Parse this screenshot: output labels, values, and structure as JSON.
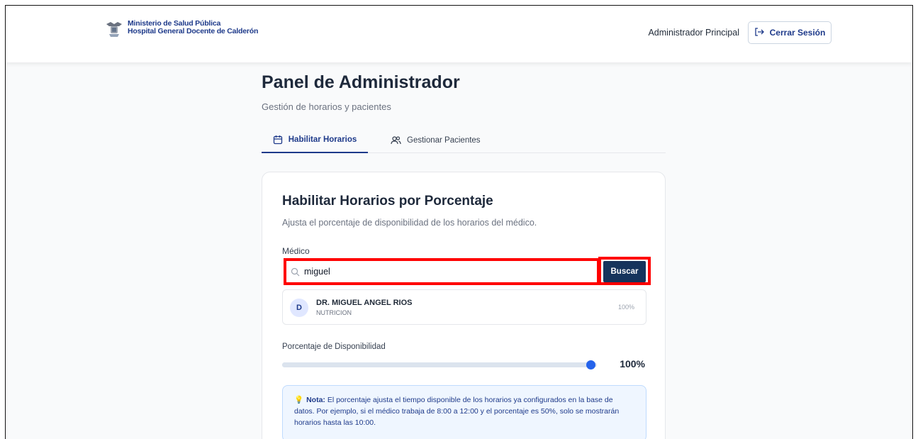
{
  "header": {
    "brand_line1": "Ministerio de Salud Pública",
    "brand_line2": "Hospital General Docente de Calderón",
    "user_name": "Administrador Principal",
    "logout_label": "Cerrar Sesión"
  },
  "page": {
    "title": "Panel de Administrador",
    "subtitle": "Gestión de horarios y pacientes"
  },
  "tabs": [
    {
      "label": "Habilitar Horarios",
      "active": true,
      "icon": "calendar-icon"
    },
    {
      "label": "Gestionar Pacientes",
      "active": false,
      "icon": "users-icon"
    }
  ],
  "card": {
    "title": "Habilitar Horarios por Porcentaje",
    "subtitle": "Ajusta el porcentaje de disponibilidad de los horarios del médico.",
    "doctor_label": "Médico",
    "search_value": "miguel",
    "search_button": "Buscar",
    "results": [
      {
        "initial": "D",
        "name": "DR. MIGUEL ANGEL RIOS",
        "specialty": "NUTRICION",
        "percent": "100%"
      }
    ],
    "percent_label": "Porcentaje de Disponibilidad",
    "percent_value": "100%",
    "percent_fraction": 0.98,
    "note_title": "Nota:",
    "note_text": " El porcentaje ajusta el tiempo disponible de los horarios ya configurados en la base de datos. Por ejemplo, si el médico trabaja de 8:00 a 12:00 y el porcentaje es 50%, solo se mostrarán horarios hasta las 10:00."
  },
  "colors": {
    "brand": "#1e3a8a",
    "button": "#16345c",
    "highlight": "#ff0000",
    "slider_thumb": "#2563eb"
  }
}
